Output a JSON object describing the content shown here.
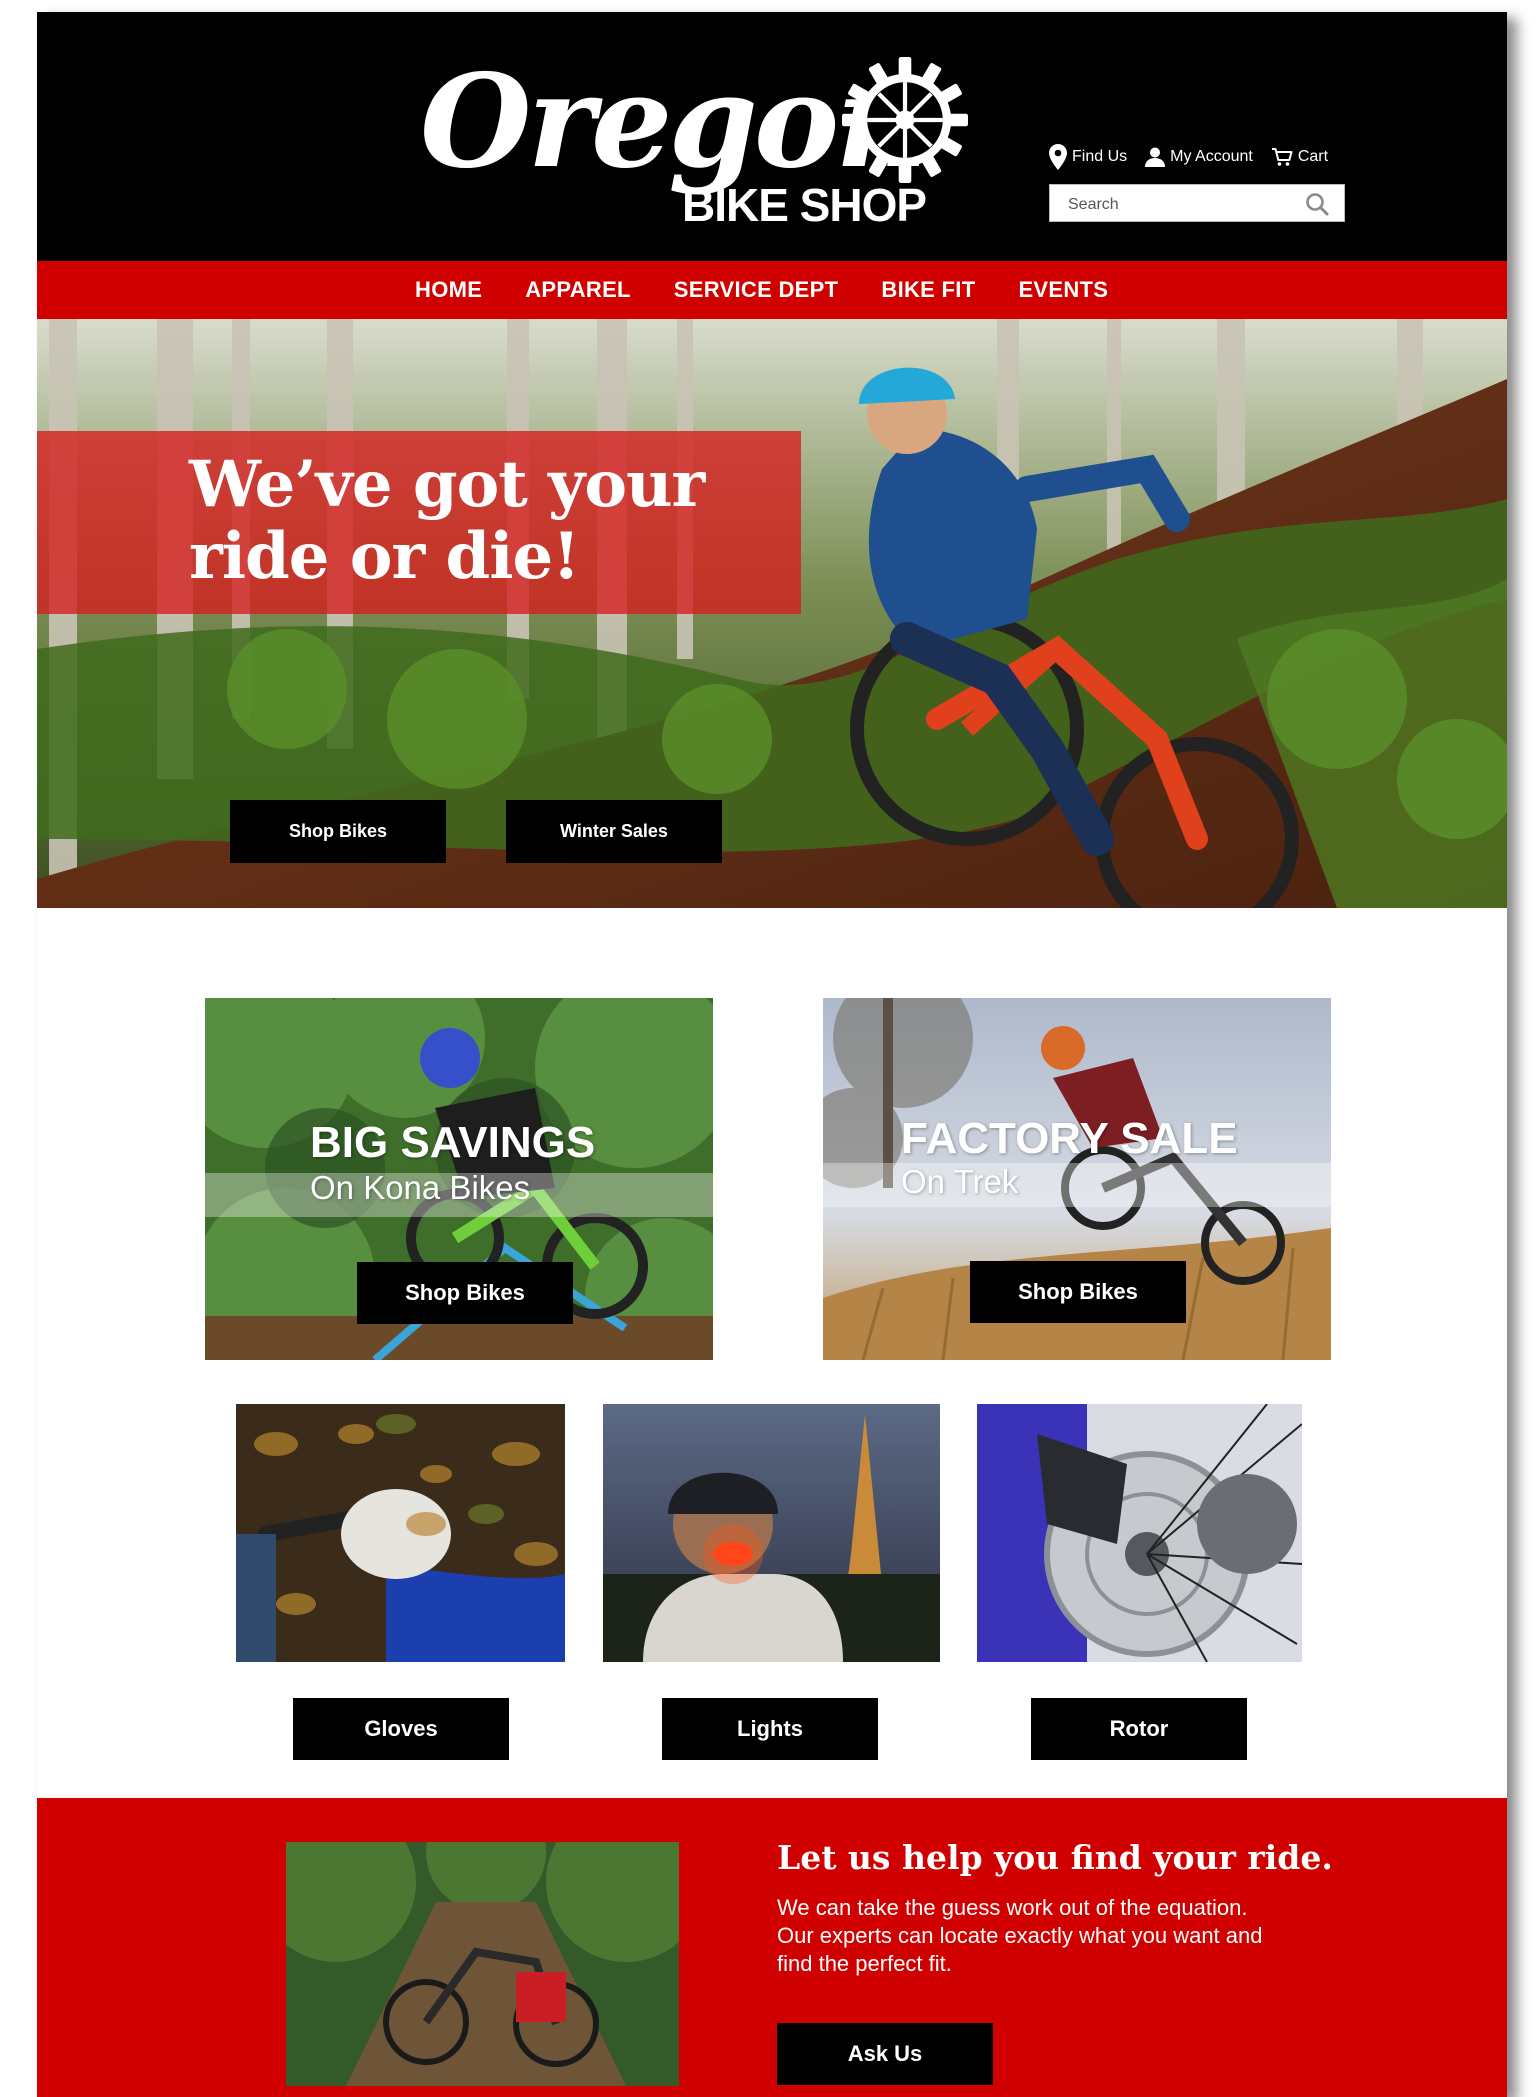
{
  "brand": {
    "logo_script": "Oregon",
    "logo_sub": "BIKE SHOP"
  },
  "utility": {
    "find_us": "Find Us",
    "my_account": "My Account",
    "cart": "Cart"
  },
  "search": {
    "placeholder": "Search"
  },
  "nav": [
    "HOME",
    "APPAREL",
    "SERVICE DEPT",
    "BIKE FIT",
    "EVENTS"
  ],
  "hero": {
    "title_line1": "We’ve got your",
    "title_line2": "ride or die!",
    "buttons": [
      "Shop Bikes",
      "Winter Sales"
    ]
  },
  "promos": [
    {
      "title": "BIG SAVINGS",
      "subtitle": "On Kona Bikes",
      "button": "Shop Bikes"
    },
    {
      "title": "FACTORY SALE",
      "subtitle": "On Trek",
      "button": "Shop Bikes"
    }
  ],
  "products": [
    {
      "label": "Gloves"
    },
    {
      "label": "Lights"
    },
    {
      "label": "Rotor"
    }
  ],
  "help": {
    "title": "Let us help you find your ride.",
    "body_lines": [
      "We can take the guess work out of the equation.",
      "Our experts can locate exactly what you want and",
      "find the perfect fit."
    ],
    "button": "Ask Us"
  },
  "colors": {
    "brand_red": "#d10000",
    "header_black": "#000000",
    "button_black": "#000000"
  },
  "icons": [
    "location-pin-icon",
    "user-icon",
    "cart-icon",
    "search-icon",
    "gear-icon"
  ]
}
